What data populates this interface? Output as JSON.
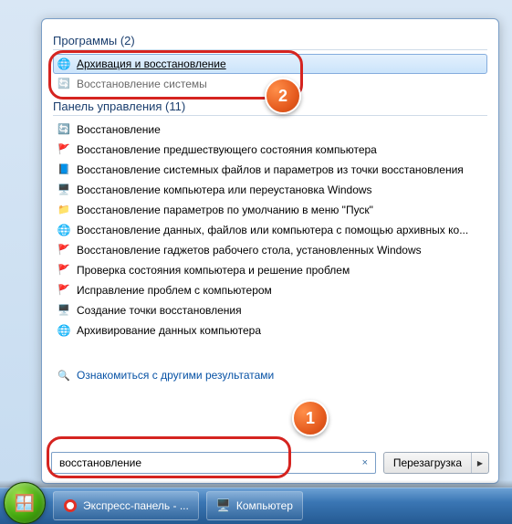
{
  "sections": {
    "programs": {
      "title": "Программы (2)",
      "items": [
        {
          "label": "Архивация и восстановление",
          "icon": "globe",
          "highlighted": true
        },
        {
          "label": "Восстановление системы",
          "icon": "restore",
          "cutoff": true
        }
      ]
    },
    "control_panel": {
      "title": "Панель управления (11)",
      "items": [
        {
          "label": "Восстановление",
          "icon": "restore"
        },
        {
          "label": "Восстановление предшествующего состояния компьютера",
          "icon": "flag"
        },
        {
          "label": "Восстановление системных файлов и параметров из точки восстановления",
          "icon": "book"
        },
        {
          "label": "Восстановление компьютера или переустановка Windows",
          "icon": "monitor"
        },
        {
          "label": "Восстановление параметров по умолчанию в меню \"Пуск\"",
          "icon": "folder"
        },
        {
          "label": "Восстановление данных, файлов или компьютера с помощью архивных ко...",
          "icon": "globe"
        },
        {
          "label": "Восстановление гаджетов рабочего стола, установленных Windows",
          "icon": "flag"
        },
        {
          "label": "Проверка состояния компьютера и решение проблем",
          "icon": "flag"
        },
        {
          "label": "Исправление проблем с компьютером",
          "icon": "flag"
        },
        {
          "label": "Создание точки восстановления",
          "icon": "monitor"
        },
        {
          "label": "Архивирование данных компьютера",
          "icon": "globe"
        }
      ]
    }
  },
  "more_results_label": "Ознакомиться с другими результатами",
  "search": {
    "value": "восстановление",
    "clear_symbol": "×"
  },
  "shutdown": {
    "label": "Перезагрузка",
    "arrow": "▶"
  },
  "taskbar": {
    "items": [
      {
        "label": "Экспресс-панель - ...",
        "icon": "opera"
      },
      {
        "label": "Компьютер",
        "icon": "comp"
      }
    ]
  },
  "annotations": {
    "step1": "1",
    "step2": "2"
  }
}
